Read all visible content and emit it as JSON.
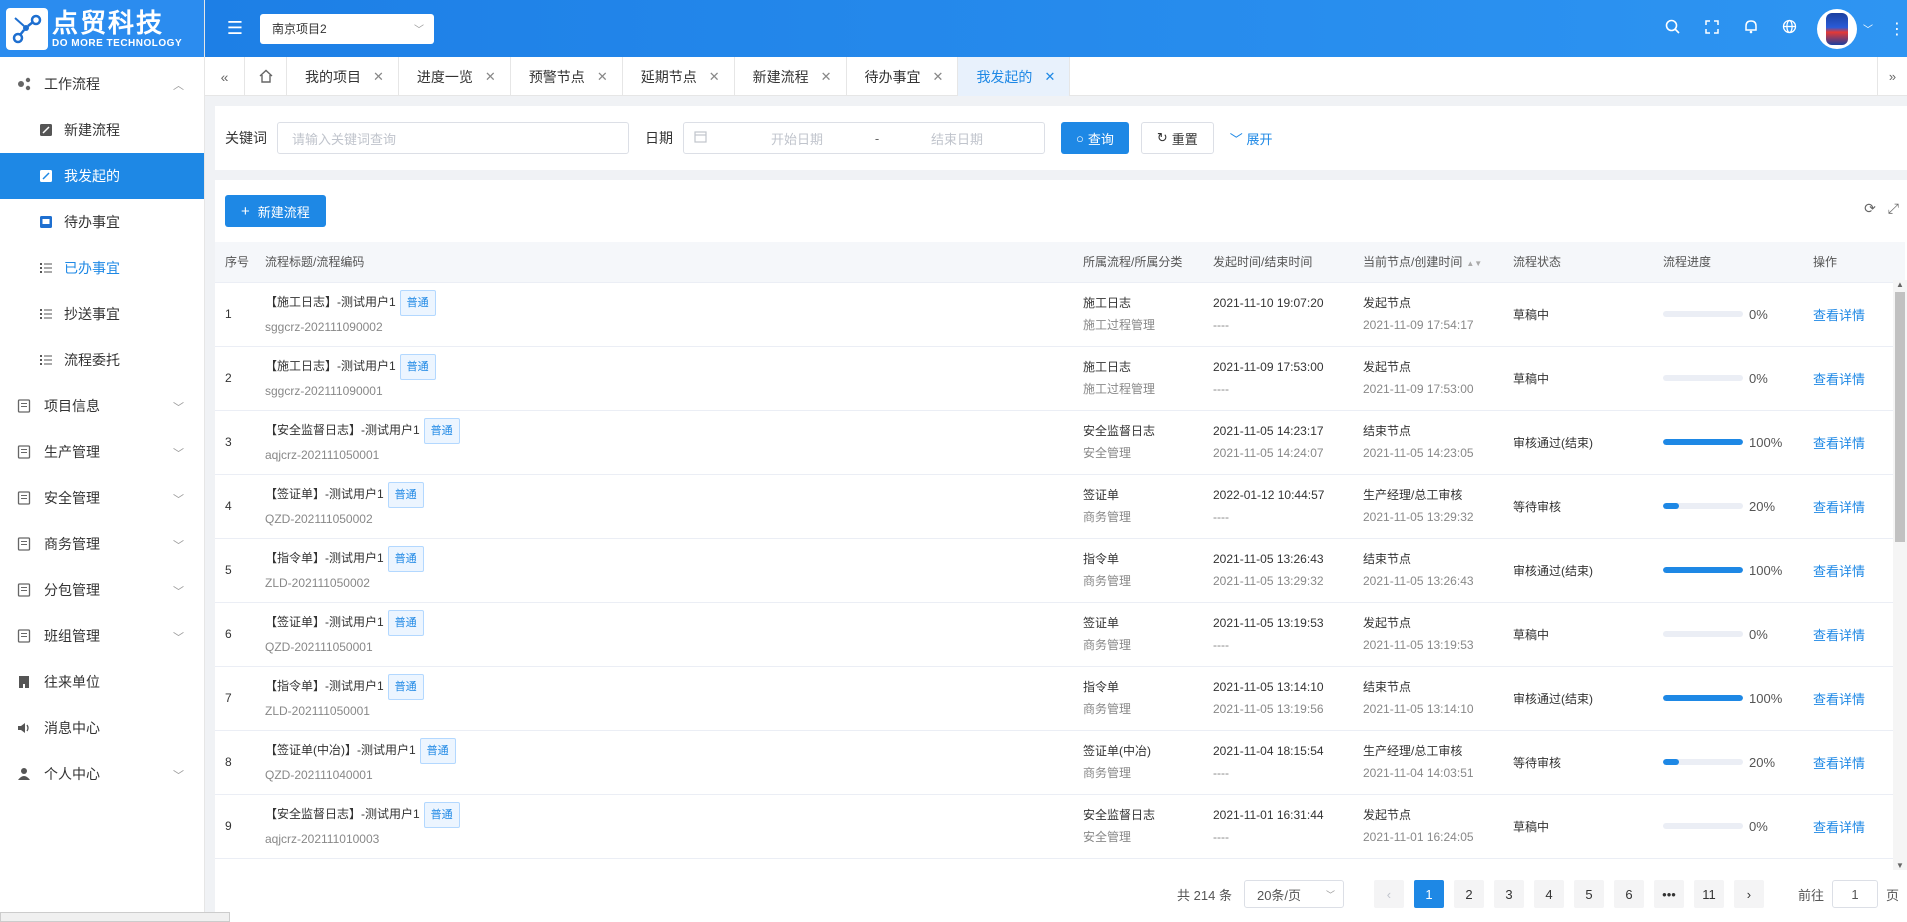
{
  "logo": {
    "cn": "点贸科技",
    "en": "DO MORE TECHNOLOGY"
  },
  "header": {
    "project": "南京项目2",
    "icons": [
      "search-icon",
      "fullscreen-icon",
      "bell-icon",
      "globe-icon"
    ]
  },
  "sidebar": {
    "workflow": "工作流程",
    "sub": [
      {
        "label": "新建流程",
        "icon": "edit-icon"
      },
      {
        "label": "我发起的",
        "icon": "edit-icon"
      },
      {
        "label": "待办事宜",
        "icon": "inbox-icon"
      },
      {
        "label": "已办事宜",
        "icon": "list-icon"
      },
      {
        "label": "抄送事宜",
        "icon": "list-icon"
      },
      {
        "label": "流程委托",
        "icon": "list-icon"
      }
    ],
    "groups": [
      {
        "label": "项目信息",
        "chev": true
      },
      {
        "label": "生产管理",
        "chev": true
      },
      {
        "label": "安全管理",
        "chev": true
      },
      {
        "label": "商务管理",
        "chev": true
      },
      {
        "label": "分包管理",
        "chev": true
      },
      {
        "label": "班组管理",
        "chev": true
      },
      {
        "label": "往来单位",
        "chev": false
      },
      {
        "label": "消息中心",
        "chev": false
      },
      {
        "label": "个人中心",
        "chev": true
      }
    ]
  },
  "tabs": [
    "我的项目",
    "进度一览",
    "预警节点",
    "延期节点",
    "新建流程",
    "待办事宜",
    "我发起的"
  ],
  "search": {
    "keyword_label": "关键词",
    "keyword_placeholder": "请输入关键词查询",
    "date_label": "日期",
    "start_placeholder": "开始日期",
    "sep": "-",
    "end_placeholder": "结束日期",
    "query": "查询",
    "reset": "重置",
    "expand": "展开"
  },
  "toolbar": {
    "new": "新建流程"
  },
  "table": {
    "headers": [
      "序号",
      "流程标题/流程编码",
      "所属流程/所属分类",
      "发起时间/结束时间",
      "当前节点/创建时间",
      "流程状态",
      "流程进度",
      "操作"
    ],
    "tag": "普通",
    "action": "查看详情",
    "rows": [
      {
        "no": "1",
        "title": "【施工日志】-测试用户1",
        "code": "sggcrz-202111090002",
        "flow": "施工日志",
        "cat": "施工过程管理",
        "start": "2021-11-10 19:07:20",
        "end": "----",
        "node": "发起节点",
        "created": "2021-11-09 17:54:17",
        "status": "草稿中",
        "progress": 0,
        "progress_text": "0%"
      },
      {
        "no": "2",
        "title": "【施工日志】-测试用户1",
        "code": "sggcrz-202111090001",
        "flow": "施工日志",
        "cat": "施工过程管理",
        "start": "2021-11-09 17:53:00",
        "end": "----",
        "node": "发起节点",
        "created": "2021-11-09 17:53:00",
        "status": "草稿中",
        "progress": 0,
        "progress_text": "0%"
      },
      {
        "no": "3",
        "title": "【安全监督日志】-测试用户1",
        "code": "aqjcrz-202111050001",
        "flow": "安全监督日志",
        "cat": "安全管理",
        "start": "2021-11-05 14:23:17",
        "end": "2021-11-05 14:24:07",
        "node": "结束节点",
        "created": "2021-11-05 14:23:05",
        "status": "审核通过(结束)",
        "progress": 100,
        "progress_text": "100%"
      },
      {
        "no": "4",
        "title": "【签证单】-测试用户1",
        "code": "QZD-202111050002",
        "flow": "签证单",
        "cat": "商务管理",
        "start": "2022-01-12 10:44:57",
        "end": "----",
        "node": "生产经理/总工审核",
        "created": "2021-11-05 13:29:32",
        "status": "等待审核",
        "progress": 20,
        "progress_text": "20%"
      },
      {
        "no": "5",
        "title": "【指令单】-测试用户1",
        "code": "ZLD-202111050002",
        "flow": "指令单",
        "cat": "商务管理",
        "start": "2021-11-05 13:26:43",
        "end": "2021-11-05 13:29:32",
        "node": "结束节点",
        "created": "2021-11-05 13:26:43",
        "status": "审核通过(结束)",
        "progress": 100,
        "progress_text": "100%"
      },
      {
        "no": "6",
        "title": "【签证单】-测试用户1",
        "code": "QZD-202111050001",
        "flow": "签证单",
        "cat": "商务管理",
        "start": "2021-11-05 13:19:53",
        "end": "----",
        "node": "发起节点",
        "created": "2021-11-05 13:19:53",
        "status": "草稿中",
        "progress": 0,
        "progress_text": "0%"
      },
      {
        "no": "7",
        "title": "【指令单】-测试用户1",
        "code": "ZLD-202111050001",
        "flow": "指令单",
        "cat": "商务管理",
        "start": "2021-11-05 13:14:10",
        "end": "2021-11-05 13:19:56",
        "node": "结束节点",
        "created": "2021-11-05 13:14:10",
        "status": "审核通过(结束)",
        "progress": 100,
        "progress_text": "100%"
      },
      {
        "no": "8",
        "title": "【签证单(中冶)】-测试用户1",
        "code": "QZD-202111040001",
        "flow": "签证单(中冶)",
        "cat": "商务管理",
        "start": "2021-11-04 18:15:54",
        "end": "----",
        "node": "生产经理/总工审核",
        "created": "2021-11-04 14:03:51",
        "status": "等待审核",
        "progress": 20,
        "progress_text": "20%"
      },
      {
        "no": "9",
        "title": "【安全监督日志】-测试用户1",
        "code": "aqjcrz-202111010003",
        "flow": "安全监督日志",
        "cat": "安全管理",
        "start": "2021-11-01 16:31:44",
        "end": "----",
        "node": "发起节点",
        "created": "2021-11-01 16:24:05",
        "status": "草稿中",
        "progress": 0,
        "progress_text": "0%"
      }
    ]
  },
  "pagination": {
    "total": "共 214 条",
    "size": "20条/页",
    "pages": [
      "1",
      "2",
      "3",
      "4",
      "5",
      "6",
      "•••",
      "11"
    ],
    "current": "1",
    "goto": "前往",
    "goto_value": "1",
    "page_suffix": "页"
  },
  "colors": {
    "primary": "#1e88e5",
    "header": "#2b8cef"
  }
}
